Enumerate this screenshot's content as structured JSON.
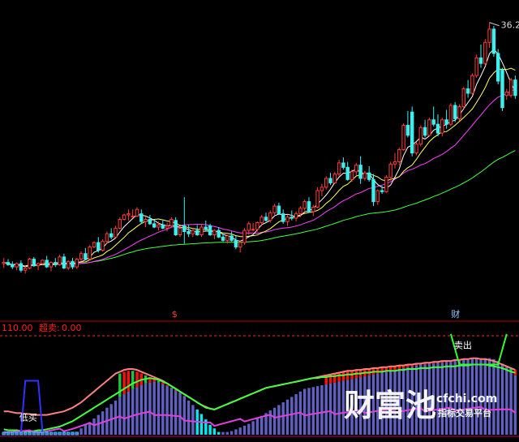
{
  "colors": {
    "background": "#000000",
    "up_candle": "#ff3b3b",
    "down_candle": "#3cf0f0",
    "ma_short": "#ffffff",
    "ma_mid": "#ffff60",
    "ma_long": "#ff40ff",
    "ma_longest": "#40ff40",
    "divider": "#b00000",
    "indicator_label": "#ff2020",
    "hist_red": "#ff1010",
    "hist_blue": "#6060c0",
    "hist_cyan": "#00e8f0",
    "hist_green": "#20c040",
    "band_upper": "#ff8080",
    "band_lower": "#40ff40",
    "watermark": "#ffffff"
  },
  "chart_data": [
    {
      "type": "candlestick",
      "title": "",
      "high_label": "36.20",
      "markers": [
        {
          "index": 40,
          "text": "$",
          "color": "#ff3b3b"
        },
        {
          "index": 105,
          "text": "财",
          "color": "#8fc8ff"
        }
      ],
      "candles": [
        {
          "o": 14.4,
          "h": 14.9,
          "l": 14.0,
          "c": 14.5
        },
        {
          "o": 14.5,
          "h": 14.8,
          "l": 14.2,
          "c": 14.3
        },
        {
          "o": 14.3,
          "h": 14.6,
          "l": 13.9,
          "c": 14.1
        },
        {
          "o": 14.1,
          "h": 14.5,
          "l": 13.8,
          "c": 14.4
        },
        {
          "o": 14.4,
          "h": 14.7,
          "l": 13.6,
          "c": 13.8
        },
        {
          "o": 13.8,
          "h": 14.2,
          "l": 13.5,
          "c": 14.0
        },
        {
          "o": 14.0,
          "h": 14.9,
          "l": 13.9,
          "c": 14.8
        },
        {
          "o": 14.8,
          "h": 15.0,
          "l": 14.1,
          "c": 14.2
        },
        {
          "o": 14.2,
          "h": 14.5,
          "l": 13.8,
          "c": 14.4
        },
        {
          "o": 14.4,
          "h": 14.8,
          "l": 14.3,
          "c": 14.7
        },
        {
          "o": 14.7,
          "h": 15.1,
          "l": 14.0,
          "c": 14.1
        },
        {
          "o": 14.1,
          "h": 14.6,
          "l": 13.7,
          "c": 14.5
        },
        {
          "o": 14.5,
          "h": 14.9,
          "l": 14.1,
          "c": 14.3
        },
        {
          "o": 14.3,
          "h": 15.2,
          "l": 14.2,
          "c": 15.0
        },
        {
          "o": 15.0,
          "h": 15.3,
          "l": 13.9,
          "c": 14.0
        },
        {
          "o": 14.0,
          "h": 14.7,
          "l": 13.8,
          "c": 14.6
        },
        {
          "o": 14.6,
          "h": 14.9,
          "l": 13.9,
          "c": 14.1
        },
        {
          "o": 14.1,
          "h": 14.9,
          "l": 13.9,
          "c": 14.8
        },
        {
          "o": 14.8,
          "h": 15.5,
          "l": 14.6,
          "c": 15.3
        },
        {
          "o": 15.3,
          "h": 15.8,
          "l": 14.7,
          "c": 14.8
        },
        {
          "o": 14.8,
          "h": 16.1,
          "l": 14.7,
          "c": 15.9
        },
        {
          "o": 15.9,
          "h": 16.4,
          "l": 15.8,
          "c": 16.3
        },
        {
          "o": 16.3,
          "h": 16.8,
          "l": 15.4,
          "c": 15.6
        },
        {
          "o": 15.6,
          "h": 16.6,
          "l": 15.5,
          "c": 16.4
        },
        {
          "o": 16.4,
          "h": 17.3,
          "l": 16.2,
          "c": 17.1
        },
        {
          "o": 17.1,
          "h": 17.6,
          "l": 16.6,
          "c": 16.8
        },
        {
          "o": 16.8,
          "h": 17.8,
          "l": 16.7,
          "c": 17.6
        },
        {
          "o": 17.6,
          "h": 18.6,
          "l": 17.5,
          "c": 18.4
        },
        {
          "o": 18.4,
          "h": 18.9,
          "l": 18.3,
          "c": 18.8
        },
        {
          "o": 18.8,
          "h": 19.3,
          "l": 18.3,
          "c": 18.9
        },
        {
          "o": 18.7,
          "h": 19.3,
          "l": 18.5,
          "c": 18.7
        },
        {
          "o": 18.7,
          "h": 19.5,
          "l": 18.6,
          "c": 19.3
        },
        {
          "o": 18.9,
          "h": 19.3,
          "l": 18.0,
          "c": 18.2
        },
        {
          "o": 18.2,
          "h": 18.6,
          "l": 17.7,
          "c": 18.4
        },
        {
          "o": 18.4,
          "h": 18.8,
          "l": 17.9,
          "c": 18.0
        },
        {
          "o": 18.0,
          "h": 18.4,
          "l": 17.6,
          "c": 17.7
        },
        {
          "o": 17.7,
          "h": 18.2,
          "l": 17.4,
          "c": 17.9
        },
        {
          "o": 17.9,
          "h": 18.3,
          "l": 17.5,
          "c": 17.6
        },
        {
          "o": 17.6,
          "h": 18.1,
          "l": 17.3,
          "c": 17.8
        },
        {
          "o": 17.8,
          "h": 18.6,
          "l": 17.7,
          "c": 18.4
        },
        {
          "o": 18.3,
          "h": 18.6,
          "l": 16.9,
          "c": 17.0
        },
        {
          "o": 17.0,
          "h": 17.8,
          "l": 16.8,
          "c": 17.6
        },
        {
          "o": 17.8,
          "h": 20.4,
          "l": 16.2,
          "c": 17.3
        },
        {
          "o": 17.3,
          "h": 17.9,
          "l": 16.8,
          "c": 17.1
        },
        {
          "o": 17.1,
          "h": 17.6,
          "l": 16.8,
          "c": 17.4
        },
        {
          "o": 17.4,
          "h": 17.9,
          "l": 16.9,
          "c": 17.0
        },
        {
          "o": 17.0,
          "h": 17.9,
          "l": 16.8,
          "c": 17.7
        },
        {
          "o": 17.7,
          "h": 18.3,
          "l": 17.4,
          "c": 17.5
        },
        {
          "o": 17.8,
          "h": 18.0,
          "l": 16.9,
          "c": 17.0
        },
        {
          "o": 17.0,
          "h": 17.5,
          "l": 16.6,
          "c": 17.4
        },
        {
          "o": 17.4,
          "h": 17.7,
          "l": 16.7,
          "c": 16.8
        },
        {
          "o": 16.8,
          "h": 17.1,
          "l": 16.4,
          "c": 16.5
        },
        {
          "o": 16.5,
          "h": 17.0,
          "l": 16.2,
          "c": 16.9
        },
        {
          "o": 16.9,
          "h": 17.3,
          "l": 16.4,
          "c": 16.5
        },
        {
          "o": 16.5,
          "h": 16.9,
          "l": 15.7,
          "c": 15.9
        },
        {
          "o": 15.9,
          "h": 16.5,
          "l": 15.4,
          "c": 16.3
        },
        {
          "o": 16.3,
          "h": 17.6,
          "l": 16.1,
          "c": 17.4
        },
        {
          "o": 17.4,
          "h": 18.2,
          "l": 17.0,
          "c": 18.0
        },
        {
          "o": 17.5,
          "h": 18.1,
          "l": 17.3,
          "c": 17.5
        },
        {
          "o": 17.5,
          "h": 18.2,
          "l": 17.3,
          "c": 18.1
        },
        {
          "o": 18.1,
          "h": 18.8,
          "l": 17.8,
          "c": 18.6
        },
        {
          "o": 18.6,
          "h": 19.0,
          "l": 18.2,
          "c": 18.3
        },
        {
          "o": 18.3,
          "h": 19.2,
          "l": 18.1,
          "c": 19.0
        },
        {
          "o": 19.0,
          "h": 19.8,
          "l": 18.8,
          "c": 19.6
        },
        {
          "o": 19.6,
          "h": 19.9,
          "l": 18.8,
          "c": 18.9
        },
        {
          "o": 18.9,
          "h": 19.3,
          "l": 18.0,
          "c": 18.2
        },
        {
          "o": 18.2,
          "h": 18.8,
          "l": 17.8,
          "c": 18.6
        },
        {
          "o": 18.6,
          "h": 19.2,
          "l": 18.3,
          "c": 18.5
        },
        {
          "o": 18.5,
          "h": 19.1,
          "l": 18.2,
          "c": 18.9
        },
        {
          "o": 18.9,
          "h": 19.6,
          "l": 18.6,
          "c": 19.4
        },
        {
          "o": 19.4,
          "h": 20.2,
          "l": 19.2,
          "c": 20.0
        },
        {
          "o": 20.0,
          "h": 20.4,
          "l": 19.0,
          "c": 19.1
        },
        {
          "o": 19.1,
          "h": 19.7,
          "l": 18.7,
          "c": 19.5
        },
        {
          "o": 19.5,
          "h": 21.3,
          "l": 19.4,
          "c": 21.0
        },
        {
          "o": 21.0,
          "h": 21.6,
          "l": 20.5,
          "c": 21.3
        },
        {
          "o": 21.3,
          "h": 22.3,
          "l": 21.1,
          "c": 22.1
        },
        {
          "o": 22.1,
          "h": 22.6,
          "l": 21.5,
          "c": 21.7
        },
        {
          "o": 21.7,
          "h": 22.7,
          "l": 21.6,
          "c": 22.5
        },
        {
          "o": 22.5,
          "h": 23.8,
          "l": 22.3,
          "c": 23.5
        },
        {
          "o": 23.5,
          "h": 24.0,
          "l": 22.9,
          "c": 23.1
        },
        {
          "o": 23.1,
          "h": 23.6,
          "l": 21.9,
          "c": 22.0
        },
        {
          "o": 22.0,
          "h": 22.9,
          "l": 21.8,
          "c": 22.7
        },
        {
          "o": 22.7,
          "h": 23.5,
          "l": 22.4,
          "c": 23.3
        },
        {
          "o": 23.3,
          "h": 24.1,
          "l": 21.6,
          "c": 22.1
        },
        {
          "o": 22.1,
          "h": 22.8,
          "l": 21.9,
          "c": 22.6
        },
        {
          "o": 22.6,
          "h": 23.2,
          "l": 21.8,
          "c": 22.0
        },
        {
          "o": 22.0,
          "h": 22.5,
          "l": 19.6,
          "c": 20.0
        },
        {
          "o": 20.0,
          "h": 21.1,
          "l": 19.7,
          "c": 21.0
        },
        {
          "o": 21.0,
          "h": 21.4,
          "l": 20.7,
          "c": 20.9
        },
        {
          "o": 20.9,
          "h": 22.4,
          "l": 20.8,
          "c": 22.2
        },
        {
          "o": 22.2,
          "h": 23.6,
          "l": 21.9,
          "c": 23.4
        },
        {
          "o": 23.4,
          "h": 24.4,
          "l": 23.0,
          "c": 23.6
        },
        {
          "o": 23.6,
          "h": 24.9,
          "l": 23.3,
          "c": 24.7
        },
        {
          "o": 24.7,
          "h": 27.1,
          "l": 24.6,
          "c": 26.9
        },
        {
          "o": 26.9,
          "h": 28.2,
          "l": 25.8,
          "c": 26.0
        },
        {
          "o": 28.1,
          "h": 28.6,
          "l": 24.1,
          "c": 24.4
        },
        {
          "o": 24.4,
          "h": 25.4,
          "l": 24.2,
          "c": 25.2
        },
        {
          "o": 25.2,
          "h": 26.9,
          "l": 25.0,
          "c": 26.7
        },
        {
          "o": 26.7,
          "h": 27.4,
          "l": 25.8,
          "c": 26.0
        },
        {
          "o": 26.0,
          "h": 27.6,
          "l": 25.9,
          "c": 27.4
        },
        {
          "o": 27.4,
          "h": 28.6,
          "l": 26.8,
          "c": 27.0
        },
        {
          "o": 27.0,
          "h": 27.9,
          "l": 25.9,
          "c": 26.2
        },
        {
          "o": 26.2,
          "h": 27.6,
          "l": 25.9,
          "c": 27.4
        },
        {
          "o": 27.4,
          "h": 28.3,
          "l": 26.6,
          "c": 27.0
        },
        {
          "o": 27.0,
          "h": 28.9,
          "l": 26.8,
          "c": 28.7
        },
        {
          "o": 28.7,
          "h": 29.0,
          "l": 27.2,
          "c": 27.5
        },
        {
          "o": 27.5,
          "h": 28.8,
          "l": 27.3,
          "c": 28.6
        },
        {
          "o": 28.6,
          "h": 30.4,
          "l": 28.4,
          "c": 30.2
        },
        {
          "o": 30.2,
          "h": 31.0,
          "l": 29.4,
          "c": 29.8
        },
        {
          "o": 29.8,
          "h": 31.6,
          "l": 29.7,
          "c": 31.4
        },
        {
          "o": 31.4,
          "h": 33.3,
          "l": 31.2,
          "c": 33.0
        },
        {
          "o": 33.0,
          "h": 34.2,
          "l": 32.1,
          "c": 32.5
        },
        {
          "o": 32.5,
          "h": 34.7,
          "l": 32.3,
          "c": 34.4
        },
        {
          "o": 34.4,
          "h": 36.2,
          "l": 33.9,
          "c": 35.6
        },
        {
          "o": 35.6,
          "h": 35.9,
          "l": 33.1,
          "c": 33.4
        },
        {
          "o": 33.4,
          "h": 33.8,
          "l": 30.6,
          "c": 30.9
        },
        {
          "o": 31.9,
          "h": 32.1,
          "l": 28.2,
          "c": 28.5
        },
        {
          "o": 29.6,
          "h": 30.2,
          "l": 29.2,
          "c": 29.9
        },
        {
          "o": 29.6,
          "h": 31.2,
          "l": 29.4,
          "c": 31.0
        },
        {
          "o": 31.0,
          "h": 31.4,
          "l": 29.3,
          "c": 29.6
        }
      ]
    },
    {
      "type": "bar",
      "title": "",
      "labels": {
        "ref_line": "110.00",
        "overbought_label": "超卖:",
        "overbought_value": "0.00",
        "buy_signal": "低买",
        "sell_signal": "卖出"
      },
      "ylim": [
        0,
        110
      ],
      "histogram": [
        3,
        3,
        3,
        3,
        3,
        3,
        3,
        3,
        3,
        3,
        3,
        3,
        3,
        3,
        3,
        3,
        3,
        3,
        7,
        11,
        14,
        18,
        22,
        26,
        30,
        34,
        38,
        42,
        45,
        48,
        51,
        53,
        55,
        57,
        58,
        59,
        58,
        56,
        54,
        52,
        50,
        47,
        43,
        38,
        33,
        28,
        23,
        17,
        11,
        7,
        3,
        3,
        3,
        4,
        6,
        8,
        10,
        12,
        15,
        18,
        21,
        24,
        27,
        30,
        33,
        36,
        39,
        42,
        45,
        48,
        51,
        52,
        53,
        54,
        55,
        56,
        57,
        58,
        59,
        60,
        61,
        62,
        63,
        64,
        65,
        66,
        67,
        68,
        69,
        70,
        71,
        72,
        73,
        74,
        75,
        76,
        77,
        78,
        78,
        79,
        79,
        80,
        80,
        81,
        81,
        82,
        82,
        83,
        83,
        84,
        84,
        85,
        85,
        85,
        84,
        82,
        79,
        75,
        70,
        66
      ],
      "upper_band": [
        26,
        26,
        25,
        24,
        24,
        23,
        23,
        22,
        22,
        22,
        22,
        23,
        24,
        25,
        26,
        28,
        30,
        33,
        36,
        40,
        44,
        48,
        52,
        56,
        60,
        64,
        68,
        70,
        72,
        73,
        73,
        72,
        70,
        68,
        66,
        64,
        62,
        60,
        57,
        54,
        51,
        48,
        45,
        42,
        39,
        36,
        33,
        31,
        29,
        28,
        30,
        32,
        34,
        36,
        38,
        40,
        42,
        44,
        46,
        48,
        50,
        52,
        53,
        54,
        55,
        56,
        57,
        58,
        59,
        60,
        61,
        62,
        63,
        64,
        65,
        66,
        67,
        68,
        69,
        70,
        71,
        71,
        72,
        72,
        73,
        73,
        74,
        74,
        75,
        75,
        76,
        76,
        77,
        77,
        78,
        78,
        79,
        79,
        80,
        80,
        81,
        81,
        82,
        82,
        82,
        83,
        83,
        84,
        84,
        85,
        85,
        84,
        84,
        83,
        82,
        80,
        78,
        76,
        74,
        72
      ],
      "lower_band": [
        6,
        5,
        5,
        5,
        4,
        4,
        4,
        4,
        5,
        5,
        6,
        7,
        8,
        9,
        11,
        13,
        15,
        18,
        21,
        24,
        27,
        30,
        33,
        36,
        39,
        42,
        45,
        48,
        51,
        54,
        57,
        59,
        61,
        62,
        63,
        62,
        61,
        59,
        57,
        54,
        51,
        48,
        45,
        42,
        39,
        36,
        33,
        30,
        29,
        28,
        30,
        32,
        34,
        36,
        38,
        40,
        42,
        44,
        46,
        48,
        50,
        52,
        53,
        54,
        55,
        56,
        57,
        58,
        59,
        60,
        61,
        62,
        63,
        63,
        64,
        64,
        65,
        65,
        66,
        66,
        67,
        67,
        68,
        68,
        69,
        69,
        70,
        70,
        70,
        71,
        71,
        71,
        72,
        72,
        73,
        73,
        73,
        74,
        74,
        74,
        75,
        75,
        75,
        76,
        76,
        76,
        77,
        77,
        77,
        78,
        78,
        78,
        78,
        77,
        76,
        75,
        74,
        72,
        70,
        69
      ],
      "signal_buy_range": [
        4,
        9
      ],
      "signal_sell_range": [
        104,
        117
      ]
    }
  ],
  "watermark": {
    "brand": "财富池",
    "site": "cfchi.com",
    "slogan": "指标交易平台"
  }
}
